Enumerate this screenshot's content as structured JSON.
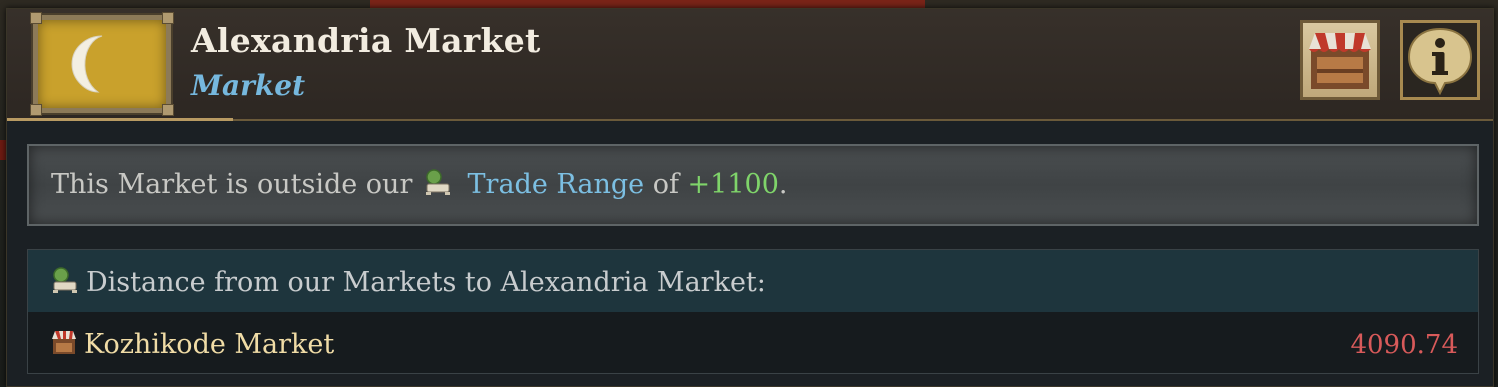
{
  "header": {
    "title": "Alexandria Market",
    "subtitle": "Market",
    "flag_color": "#c9a12c",
    "flag_emblem": "crescent-moon-icon",
    "buttons": [
      {
        "name": "market-stall-button",
        "icon": "market-stall-icon"
      },
      {
        "name": "info-button",
        "icon": "info-icon"
      }
    ]
  },
  "notice": {
    "prefix": "This Market is outside our",
    "icon": "trade-range-icon",
    "link": "Trade Range",
    "middle": "of",
    "value": "+1100",
    "suffix": "."
  },
  "distances": {
    "header_icon": "trade-range-icon",
    "header": "Distance from our Markets to Alexandria Market:",
    "rows": [
      {
        "icon": "market-stall-icon",
        "name": "Kozhikode Market",
        "value": "4090.74"
      }
    ]
  },
  "colors": {
    "title": "#f2ece0",
    "subtitle": "#76b8de",
    "link": "#7cbfe2",
    "positive": "#7fd46a",
    "distance_value": "#d85a5a",
    "market_name": "#f0dca6"
  }
}
